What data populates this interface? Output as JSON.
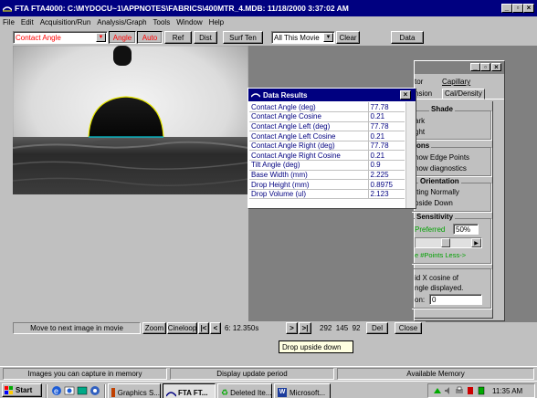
{
  "app": {
    "title": "FTA FTA4000: C:\\MYDOCU~1\\APPNOTES\\FABRICS\\400MTR_4.MDB: 11/18/2000 3:37:02 AM"
  },
  "menu": [
    "File",
    "Edit",
    "Acquisition/Run",
    "Analysis/Graph",
    "Tools",
    "Window",
    "Help"
  ],
  "toolbar": {
    "measurement_select": "Contact Angle",
    "angle_label": "Angle",
    "auto_label": "Auto",
    "ref_label": "Ref",
    "dist_label": "Dist",
    "surften_label": "Surf Ten",
    "scope_select": "All This Movie",
    "clear_label": "Clear",
    "data_label": "Data"
  },
  "data_results": {
    "title": "Data Results",
    "rows": [
      {
        "label": "Contact Angle (deg)",
        "value": "77.78"
      },
      {
        "label": "Contact Angle Cosine",
        "value": "0.21"
      },
      {
        "label": "Contact Angle Left (deg)",
        "value": "77.78"
      },
      {
        "label": "Contact Angle Left Cosine",
        "value": "0.21"
      },
      {
        "label": "Contact Angle Right (deg)",
        "value": "77.78"
      },
      {
        "label": "Contact Angle Right Cosine",
        "value": "0.21"
      },
      {
        "label": "Tilt Angle (deg)",
        "value": "0.9"
      },
      {
        "label": "Base Width (mm)",
        "value": "2.225"
      },
      {
        "label": "Drop Height (mm)",
        "value": "0.8975"
      },
      {
        "label": "Drop Volume (ul)",
        "value": "2.123"
      }
    ]
  },
  "side_panel": {
    "tabs_row1": [
      "tor",
      "Capillary"
    ],
    "tabs_row2": [
      "nsion",
      "Cal/Density"
    ],
    "shade_title": "Shade",
    "shade_options": [
      "ark",
      "ght"
    ],
    "options_title": "ons",
    "options_items": [
      "how Edge Points",
      "how diagnostics"
    ],
    "orientation_title": "Orientation",
    "orientation_options": [
      "tting Normally",
      "pside Down"
    ],
    "sensitivity_title": "Sensitivity",
    "preferred_label": "Preferred",
    "preferred_value": "50%",
    "points_hint": "e #Points  Less->",
    "cosine_text_1": "id X cosine of",
    "cosine_text_2": "ngle displayed.",
    "position_label": "on:",
    "position_value": "0"
  },
  "movie_bar": {
    "hint": "Move to next image in movie",
    "zoom_label": "Zoom",
    "cineloop_label": "Cineloop",
    "first_label": "|<",
    "prev_label": "<",
    "frame_time": "6: 12.350s",
    "next_label": ">",
    "last_label": ">|",
    "coords": "292  145  92",
    "del_label": "Del",
    "close_label": "Close"
  },
  "tooltip": "Drop upside down",
  "status_bar": [
    "Images you can capture in memory",
    "Display update period",
    "Available Memory"
  ],
  "taskbar": {
    "start_label": "Start",
    "tasks": [
      "Graphics S...",
      "FTA FT...",
      "Deleted Ite...",
      "Microsoft..."
    ],
    "clock": "11:35 AM"
  },
  "colors": {
    "title_bar": "#000080",
    "desktop": "#808080",
    "drop_outline": "#e8e800",
    "baseline": "#00c8d8",
    "toggle_red": "#ff0000"
  }
}
